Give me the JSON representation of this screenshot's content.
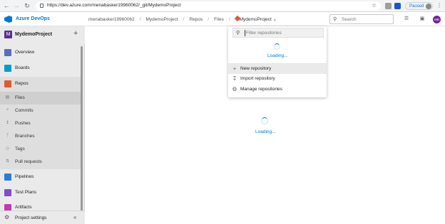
{
  "browser": {
    "url": "https://dev.azure.com/menabasker19960062/_git/MydemoProject",
    "paused_label": "Paused"
  },
  "topbar": {
    "app_title": "Azure DevOps",
    "breadcrumbs": [
      "menabasker19960062",
      "MydemoProject",
      "Repos",
      "Files"
    ],
    "repo_crumb": "MydemoProject",
    "search_placeholder": "Search",
    "user_initials": "MB"
  },
  "sidebar": {
    "project_badge": "M",
    "project_name": "MydemoProject",
    "items": [
      {
        "label": "Overview",
        "icon": "overview-icon",
        "color": "#5c6bc0"
      },
      {
        "label": "Boards",
        "icon": "boards-icon",
        "color": "#009ccc"
      },
      {
        "label": "Repos",
        "icon": "repos-icon",
        "color": "#e05a2b"
      },
      {
        "label": "Files",
        "icon": "file-icon"
      },
      {
        "label": "Commits",
        "icon": "commit-icon"
      },
      {
        "label": "Pushes",
        "icon": "push-icon"
      },
      {
        "label": "Branches",
        "icon": "branch-icon"
      },
      {
        "label": "Tags",
        "icon": "tag-icon"
      },
      {
        "label": "Pull requests",
        "icon": "pull-request-icon"
      },
      {
        "label": "Pipelines",
        "icon": "pipelines-icon",
        "color": "#2e7bd6"
      },
      {
        "label": "Test Plans",
        "icon": "test-plans-icon",
        "color": "#7b4fcf"
      },
      {
        "label": "Artifacts",
        "icon": "artifacts-icon",
        "color": "#c239b3"
      }
    ],
    "footer_label": "Project settings"
  },
  "main": {
    "loading_text": "Loading..."
  },
  "dropdown": {
    "filter_placeholder": "Filter repositories",
    "loading_text": "Loading...",
    "actions": [
      {
        "label": "New repository",
        "icon": "plus-icon"
      },
      {
        "label": "Import repository",
        "icon": "import-icon"
      },
      {
        "label": "Manage repositories",
        "icon": "gear-icon"
      }
    ]
  }
}
